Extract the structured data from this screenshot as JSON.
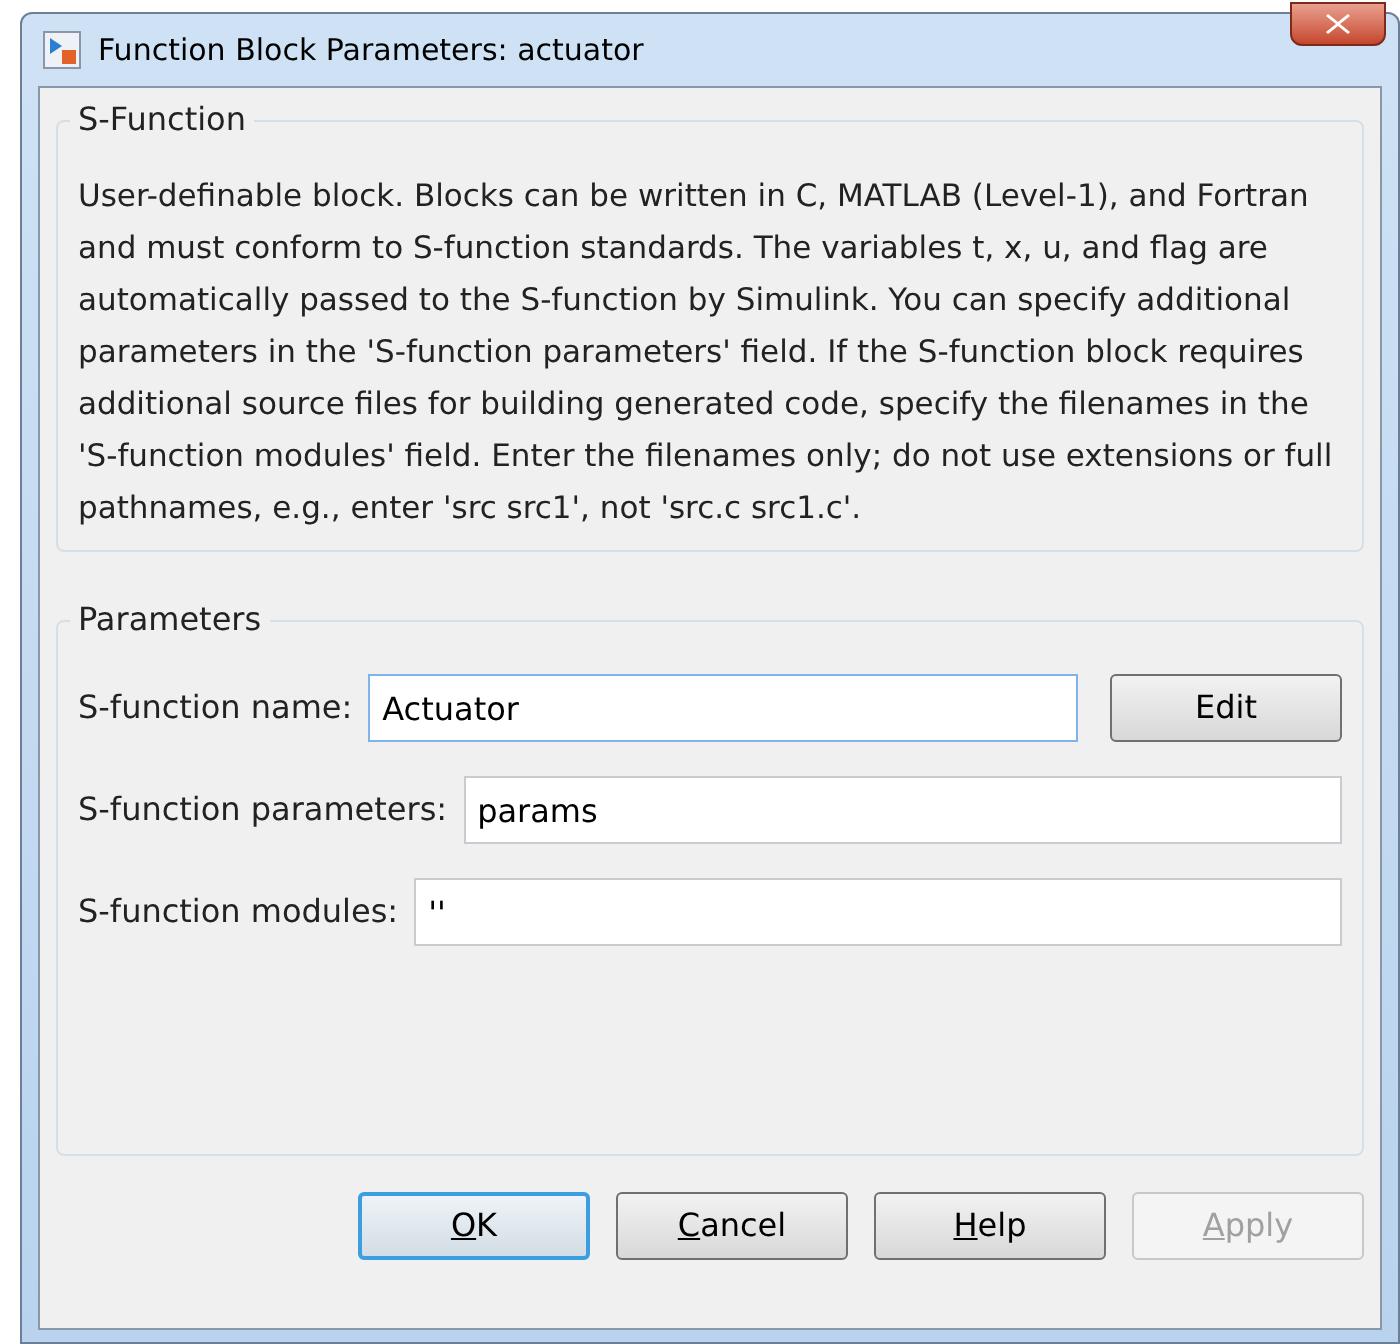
{
  "window": {
    "title": "Function Block Parameters: actuator"
  },
  "description_group": {
    "title": "S-Function",
    "text": "User-definable block.  Blocks can be written in C, MATLAB (Level-1), and Fortran and must conform to S-function standards.  The variables t, x, u, and flag are automatically passed to the S-function by Simulink.  You can specify additional parameters in the 'S-function parameters' field. If the S-function block requires additional source files for building generated code, specify the filenames in the 'S-function modules' field. Enter the filenames only; do not use extensions or full pathnames, e.g., enter 'src src1', not 'src.c src1.c'."
  },
  "parameters_group": {
    "title": "Parameters",
    "fields": [
      {
        "label": "S-function name:",
        "value": "Actuator",
        "focused": true,
        "button": "Edit"
      },
      {
        "label": "S-function parameters:",
        "value": "params",
        "focused": false
      },
      {
        "label": "S-function modules:",
        "value": "''",
        "focused": false
      }
    ]
  },
  "buttons": [
    {
      "key": "O",
      "rest": "K",
      "default": true,
      "disabled": false
    },
    {
      "key": "C",
      "rest": "ancel",
      "default": false,
      "disabled": false
    },
    {
      "key": "H",
      "rest": "elp",
      "default": false,
      "disabled": false
    },
    {
      "key": "A",
      "rest": "pply",
      "default": false,
      "disabled": true
    }
  ]
}
